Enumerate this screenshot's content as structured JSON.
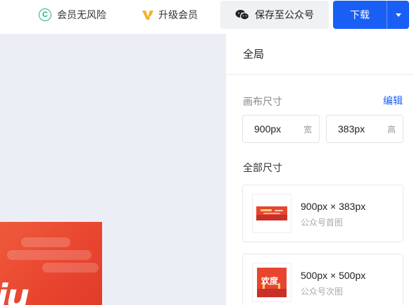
{
  "topbar": {
    "safe_label": "会员无风险",
    "vip_label": "升级会员",
    "save_label": "保存至公众号",
    "download_label": "下载"
  },
  "colors": {
    "accent": "#1a5ff5",
    "safe_green": "#22b573",
    "vip_gold": "#f5b225",
    "canvas_bg": "#eceef6",
    "poster_red": "#e8452f"
  },
  "icons": {
    "safe": "copyright-c-icon",
    "vip": "vip-icon",
    "wechat": "wechat-icon",
    "dropdown": "caret-down-icon"
  },
  "panel": {
    "title": "全局",
    "canvas_size_label": "画布尺寸",
    "edit_label": "编辑",
    "width_value": "900px",
    "width_unit": "宽",
    "height_value": "383px",
    "height_unit": "高",
    "all_sizes_label": "全部尺寸",
    "sizes": [
      {
        "title": "900px × 383px",
        "subtitle": "公众号首图",
        "thumb_text": ""
      },
      {
        "title": "500px × 500px",
        "subtitle": "公众号次图",
        "thumb_text": "欢度"
      }
    ]
  },
  "canvas": {
    "poster_text": "iu"
  }
}
